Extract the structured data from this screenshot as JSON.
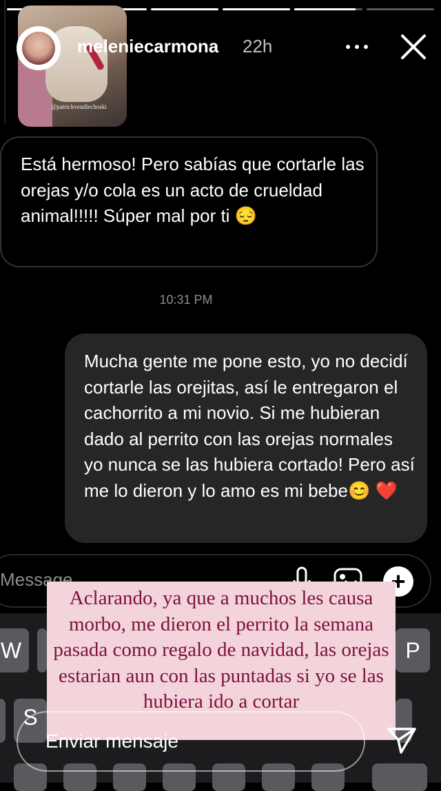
{
  "story": {
    "progress_segments": [
      1,
      1,
      1,
      1,
      0.9,
      0
    ],
    "username": "meleniecarmona",
    "time": "22h",
    "photo_tag": "@patrickvendlechoski"
  },
  "messages": {
    "incoming": "Está hermoso! Pero sabías que cortarle las orejas y/o cola es un acto de crueldad animal!!!!!  Súper mal por ti 😔",
    "timestamp": "10:31 PM",
    "outgoing": "Mucha gente me pone esto, yo no decidí cortarle las orejitas, así le entregaron el cachorrito a mi novio. Si me hubieran dado al perrito con las orejas normales yo nunca se las hubiera cortado! Pero así me lo dieron y lo amo es mi bebe😊 ❤️"
  },
  "composer": {
    "placeholder": "Message..."
  },
  "keyboard": {
    "visible_keys": [
      "W",
      "P",
      "S"
    ]
  },
  "overlay_text": "Aclarando, ya que a muchos les causa morbo, me dieron el perrito la semana pasada como regalo de navidad, las orejas estarian aun con las puntadas si yo se las hubiera ido a cortar",
  "reply": {
    "placeholder": "Enviar mensaje"
  },
  "colors": {
    "overlay_bg": "#f2d4da",
    "overlay_text": "#7e0f3f",
    "bubble_out": "#262626",
    "background": "#000000"
  }
}
